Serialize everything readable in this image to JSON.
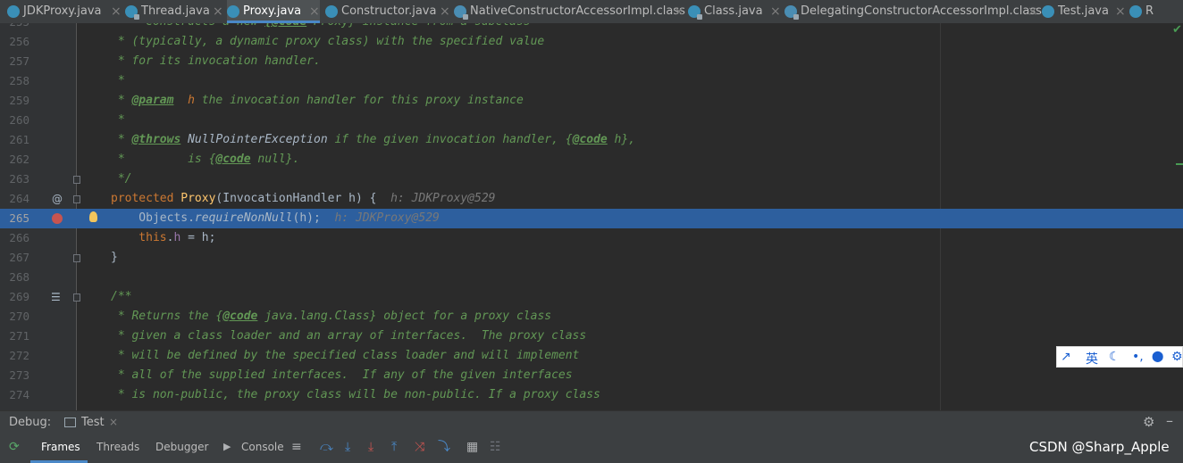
{
  "tabs": [
    {
      "label": "JDKProxy.java"
    },
    {
      "label": "Thread.java"
    },
    {
      "label": "Proxy.java"
    },
    {
      "label": "Constructor.java"
    },
    {
      "label": "NativeConstructorAccessorImpl.class"
    },
    {
      "label": "Class.java"
    },
    {
      "label": "DelegatingConstructorAccessorImpl.class"
    },
    {
      "label": "Test.java"
    },
    {
      "label": "R"
    }
  ],
  "close_glyph": "×",
  "editor": {
    "lines": [
      {
        "n": "255",
        "p": [
          {
            "t": "cm",
            "v": "   * Constructs a new "
          },
          {
            "t": "tag",
            "v": "{@code"
          },
          {
            "t": "cm",
            "v": " Proxy} instance from a subclass"
          }
        ]
      },
      {
        "n": "256",
        "p": [
          {
            "t": "cm",
            "v": " * (typically, a dynamic proxy class) with the specified value"
          }
        ]
      },
      {
        "n": "257",
        "p": [
          {
            "t": "cm",
            "v": " * for its invocation handler."
          }
        ]
      },
      {
        "n": "258",
        "p": [
          {
            "t": "cm",
            "v": " *"
          }
        ]
      },
      {
        "n": "259",
        "p": [
          {
            "t": "cm",
            "v": " * "
          },
          {
            "t": "tag",
            "v": "@param"
          },
          {
            "t": "cm",
            "v": "  "
          },
          {
            "t": "par",
            "v": "h"
          },
          {
            "t": "cm",
            "v": " the invocation handler for this proxy instance"
          }
        ]
      },
      {
        "n": "260",
        "p": [
          {
            "t": "cm",
            "v": " *"
          }
        ]
      },
      {
        "n": "261",
        "p": [
          {
            "t": "cm",
            "v": " * "
          },
          {
            "t": "tag",
            "v": "@throws"
          },
          {
            "t": "cm",
            "v": " "
          },
          {
            "t": "cmref",
            "v": "NullPointerException"
          },
          {
            "t": "cm",
            "v": " if the given invocation handler, {"
          },
          {
            "t": "tag",
            "v": "@code"
          },
          {
            "t": "cm",
            "v": " h},"
          }
        ]
      },
      {
        "n": "262",
        "p": [
          {
            "t": "cm",
            "v": " *         is {"
          },
          {
            "t": "tag",
            "v": "@code"
          },
          {
            "t": "cm",
            "v": " null}."
          }
        ]
      },
      {
        "n": "263",
        "p": [
          {
            "t": "cm",
            "v": " */"
          }
        ]
      },
      {
        "n": "264",
        "p": [
          {
            "t": "kw",
            "v": "protected "
          },
          {
            "t": "fn",
            "v": "Proxy"
          },
          {
            "t": "pl",
            "v": "(InvocationHandler h) {  "
          },
          {
            "t": "inl",
            "v": "h: JDKProxy@529"
          }
        ]
      },
      {
        "n": "265",
        "p": [
          {
            "t": "pl",
            "v": "    Objects."
          },
          {
            "t": "stat",
            "v": "requireNonNull"
          },
          {
            "t": "pl",
            "v": "(h);  "
          },
          {
            "t": "inl",
            "v": "h: JDKProxy@529"
          }
        ]
      },
      {
        "n": "266",
        "p": [
          {
            "t": "kw",
            "v": "    this"
          },
          {
            "t": "pl",
            "v": "."
          },
          {
            "t": "fld",
            "v": "h"
          },
          {
            "t": "pl",
            "v": " = h;"
          }
        ]
      },
      {
        "n": "267",
        "p": [
          {
            "t": "pl",
            "v": "}"
          }
        ]
      },
      {
        "n": "268",
        "p": []
      },
      {
        "n": "269",
        "p": [
          {
            "t": "cm",
            "v": "/**"
          }
        ]
      },
      {
        "n": "270",
        "p": [
          {
            "t": "cm",
            "v": " * Returns the {"
          },
          {
            "t": "tag",
            "v": "@code"
          },
          {
            "t": "cm",
            "v": " java.lang.Class} object for a proxy class"
          }
        ]
      },
      {
        "n": "271",
        "p": [
          {
            "t": "cm",
            "v": " * given a class loader and an array of interfaces.  The proxy class"
          }
        ]
      },
      {
        "n": "272",
        "p": [
          {
            "t": "cm",
            "v": " * will be defined by the specified class loader and will implement"
          }
        ]
      },
      {
        "n": "273",
        "p": [
          {
            "t": "cm",
            "v": " * all of the supplied interfaces.  If any of the given interfaces"
          }
        ]
      },
      {
        "n": "274",
        "p": [
          {
            "t": "cm",
            "v": " * is non-public, the proxy class will be non-public. If a proxy class"
          }
        ]
      }
    ],
    "highlighted_line": "265",
    "override_marker": "@"
  },
  "ime": {
    "lang": "英",
    "moon": "☾",
    "dot": "•,",
    "user": "👤",
    "gear": "⚙",
    "arrow": "↗"
  },
  "debug": {
    "label": "Debug:",
    "session": "Test",
    "tabs": [
      "Frames",
      "Threads",
      "Debugger",
      "Console"
    ],
    "watermark": "CSDN @Sharp_Apple"
  },
  "colors": {
    "accent": "#4a88c7",
    "highlight": "#2d5f9e",
    "comment": "#629755",
    "keyword": "#cc7832"
  }
}
